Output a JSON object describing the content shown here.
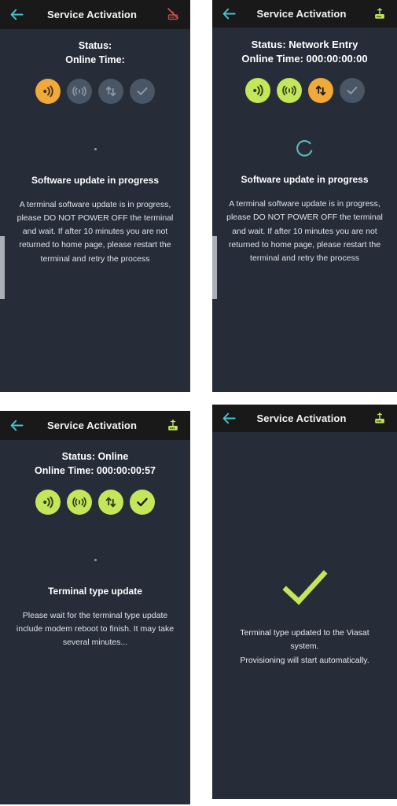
{
  "theme": {
    "panel_bg": "#262d39",
    "appbar_bg": "#191919",
    "accent_teal": "#49c4d4",
    "accent_green": "#c3e65a",
    "accent_orange": "#f2a93b",
    "inactive_grey": "#4a5565",
    "modem_red": "#b24a44",
    "modem_green": "#c3e65a",
    "text_primary": "#ffffff",
    "text_secondary": "#dfe3e7"
  },
  "panels": [
    {
      "id": "panel-1",
      "appbar": {
        "back_icon": "back-arrow-icon",
        "title": "Service Activation",
        "modem_icon": "modem-disconnected-icon",
        "modem_state": "disconnected"
      },
      "status": {
        "status_label": "Status:",
        "online_time_label": "Online Time:"
      },
      "progress_icons": [
        {
          "name": "signal-strength-icon",
          "state": "active"
        },
        {
          "name": "antenna-icon",
          "state": "inactive"
        },
        {
          "name": "data-transfer-icon",
          "state": "inactive"
        },
        {
          "name": "check-icon",
          "state": "inactive"
        }
      ],
      "spinner": "tiny-dot",
      "message": {
        "title": "Software update in progress",
        "body": "A terminal software update is in progress, please DO NOT POWER OFF the terminal and wait. If after 10 minutes you are not returned to home page, please restart the terminal and retry the process"
      },
      "has_scrollbar": true
    },
    {
      "id": "panel-2",
      "appbar": {
        "back_icon": "back-arrow-icon",
        "title": "Service Activation",
        "modem_icon": "modem-connected-icon",
        "modem_state": "connected"
      },
      "status": {
        "status_label": "Status: Network Entry",
        "online_time_label": "Online Time: 000:00:00:00"
      },
      "progress_icons": [
        {
          "name": "signal-strength-icon",
          "state": "complete"
        },
        {
          "name": "antenna-icon",
          "state": "complete"
        },
        {
          "name": "data-transfer-icon",
          "state": "active"
        },
        {
          "name": "check-icon",
          "state": "inactive"
        }
      ],
      "spinner": "arc",
      "message": {
        "title": "Software update in progress",
        "body": "A terminal software update is in progress, please DO NOT POWER OFF the terminal and wait. If after 10 minutes you are not returned to home page, please restart the terminal and retry the process"
      },
      "has_scrollbar": true
    },
    {
      "id": "panel-3",
      "appbar": {
        "back_icon": "back-arrow-icon",
        "title": "Service Activation",
        "modem_icon": "modem-connected-icon",
        "modem_state": "connected"
      },
      "status": {
        "status_label": "Status: Online",
        "online_time_label": "Online Time: 000:00:00:57"
      },
      "progress_icons": [
        {
          "name": "signal-strength-icon",
          "state": "complete"
        },
        {
          "name": "antenna-icon",
          "state": "complete"
        },
        {
          "name": "data-transfer-icon",
          "state": "complete"
        },
        {
          "name": "check-icon",
          "state": "complete"
        }
      ],
      "spinner": "tiny-dot",
      "message": {
        "title": "Terminal type update",
        "body": "Please wait for the terminal type update include modem reboot to finish. It may take several minutes..."
      },
      "has_scrollbar": false
    },
    {
      "id": "panel-4",
      "appbar": {
        "back_icon": "back-arrow-icon",
        "title": "Service Activation",
        "modem_icon": "modem-connected-icon",
        "modem_state": "connected"
      },
      "success": {
        "check_icon": "large-check-icon",
        "message_line_1": "Terminal type updated to the Viasat system.",
        "message_line_2": "Provisioning will start automatically."
      },
      "has_scrollbar": false
    }
  ]
}
